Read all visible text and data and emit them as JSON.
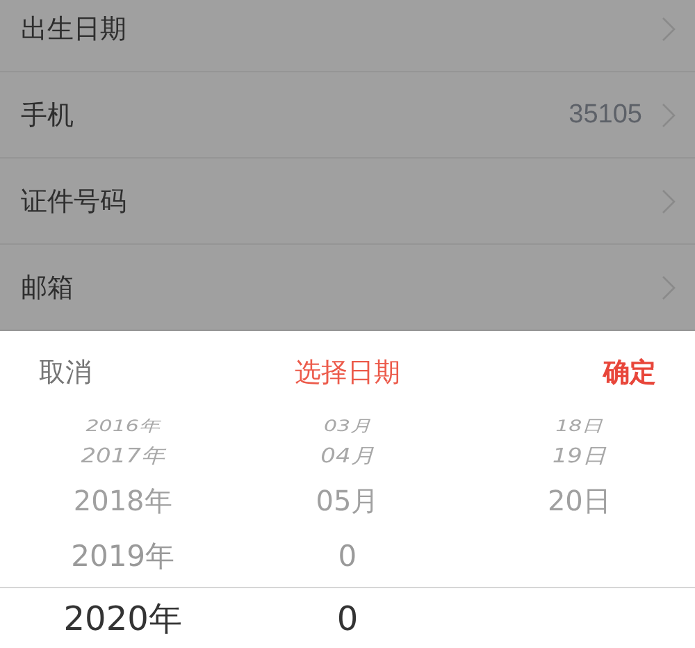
{
  "settings_rows": [
    {
      "label": "出生日期"
    },
    {
      "label": "手机",
      "value": "35105"
    },
    {
      "label": "证件号码"
    },
    {
      "label": "邮箱"
    }
  ],
  "date_picker": {
    "cancel": "取消",
    "title": "选择日期",
    "confirm": "确定",
    "rows": [
      {
        "year": "2016年",
        "month": "03月",
        "day": "18日",
        "selected": false
      },
      {
        "year": "2017年",
        "month": "04月",
        "day": "19日",
        "selected": false
      },
      {
        "year": "2018年",
        "month": "05月",
        "day": "20日",
        "selected": false
      },
      {
        "year": "2019年",
        "month": "0",
        "selected": false
      },
      {
        "year": "2020年",
        "month": "0",
        "selected": true
      }
    ]
  }
}
